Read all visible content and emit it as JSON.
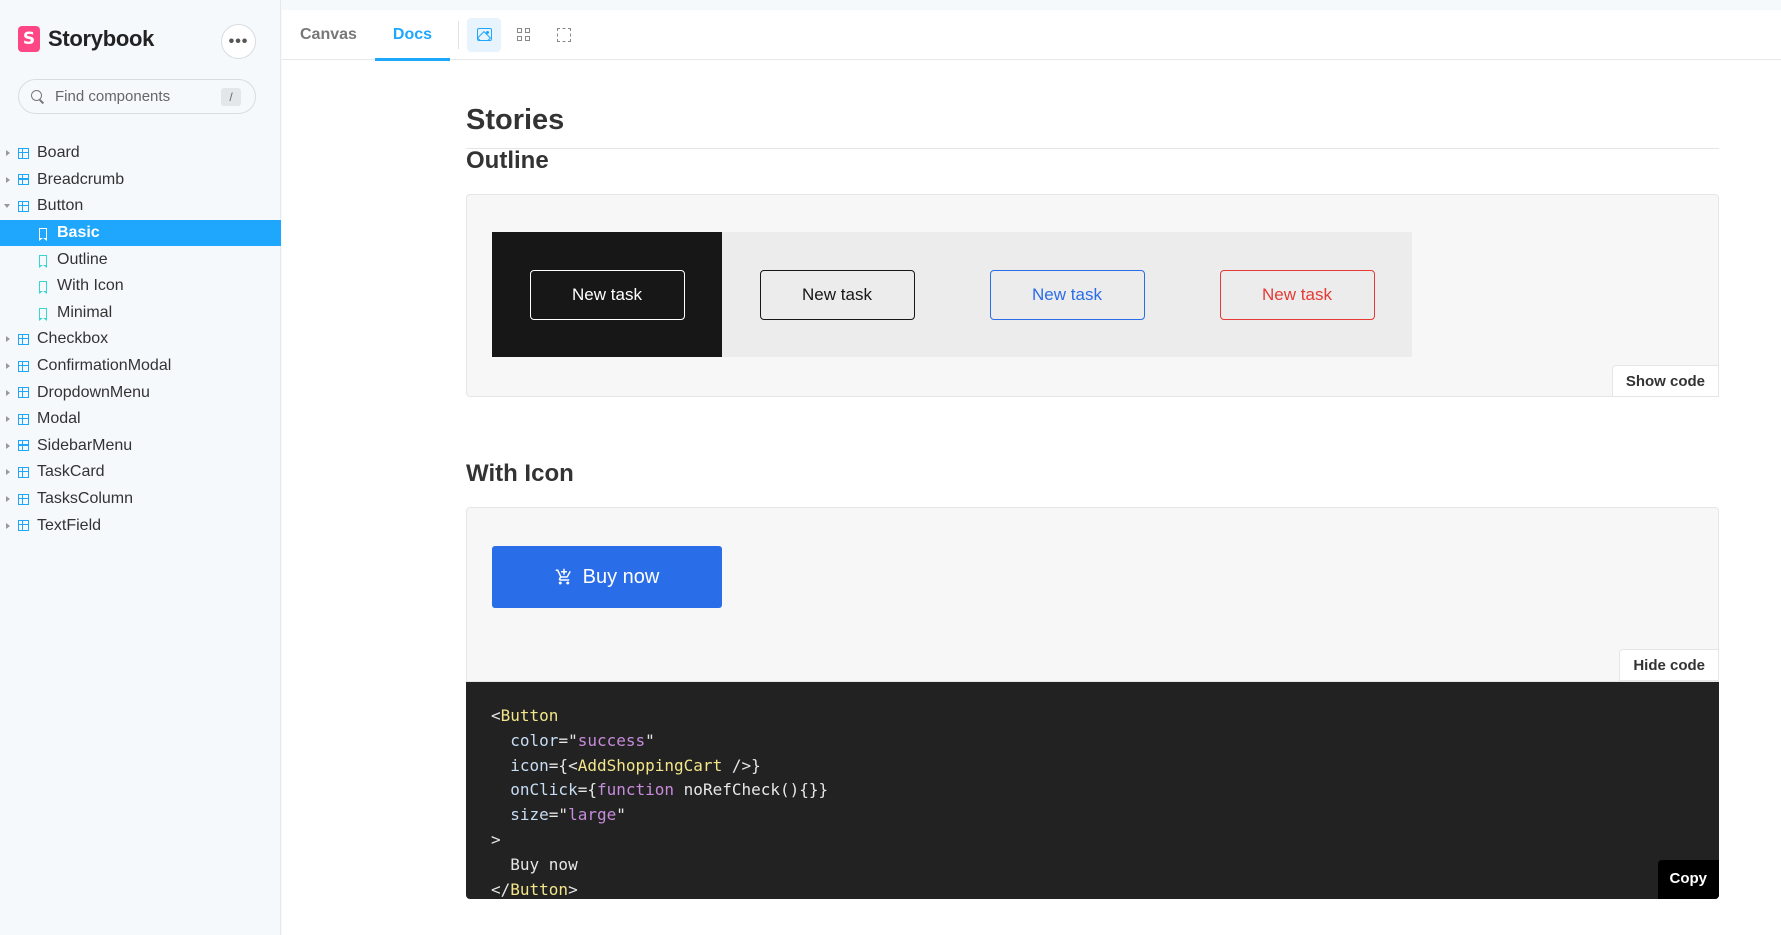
{
  "sidebar": {
    "brand": {
      "logo_letter": "S",
      "name": "Storybook"
    },
    "menu_button": "•••",
    "search": {
      "placeholder": "Find components",
      "shortcut": "/"
    },
    "tree": [
      {
        "label": "Board",
        "type": "component",
        "expanded": false
      },
      {
        "label": "Breadcrumb",
        "type": "component",
        "expanded": false
      },
      {
        "label": "Button",
        "type": "component",
        "expanded": true
      },
      {
        "label": "Basic",
        "type": "story",
        "active": true
      },
      {
        "label": "Outline",
        "type": "story"
      },
      {
        "label": "With Icon",
        "type": "story"
      },
      {
        "label": "Minimal",
        "type": "story"
      },
      {
        "label": "Checkbox",
        "type": "component",
        "expanded": false
      },
      {
        "label": "ConfirmationModal",
        "type": "component",
        "expanded": false
      },
      {
        "label": "DropdownMenu",
        "type": "component",
        "expanded": false
      },
      {
        "label": "Modal",
        "type": "component",
        "expanded": false
      },
      {
        "label": "SidebarMenu",
        "type": "component",
        "expanded": false
      },
      {
        "label": "TaskCard",
        "type": "component",
        "expanded": false
      },
      {
        "label": "TasksColumn",
        "type": "component",
        "expanded": false
      },
      {
        "label": "TextField",
        "type": "component",
        "expanded": false
      }
    ]
  },
  "toolbar": {
    "tabs": [
      {
        "label": "Canvas",
        "active": false
      },
      {
        "label": "Docs",
        "active": true
      }
    ],
    "tools": [
      "image-icon",
      "grid-icon",
      "frame-icon"
    ]
  },
  "docs": {
    "heading": "Stories",
    "outline": {
      "title": "Outline",
      "buttons": [
        {
          "label": "New task",
          "variant": "white-on-dark"
        },
        {
          "label": "New task",
          "variant": "black"
        },
        {
          "label": "New task",
          "variant": "blue"
        },
        {
          "label": "New task",
          "variant": "red"
        }
      ],
      "toggle_label": "Show code"
    },
    "with_icon": {
      "title": "With Icon",
      "button_label": "Buy now",
      "button_icon": "add-shopping-cart-icon",
      "toggle_label": "Hide code",
      "code": {
        "l1_tag": "Button",
        "l2_attr": "color",
        "l2_val": "success",
        "l3_attr": "icon",
        "l3_comp": "AddShoppingCart",
        "l4_attr": "onClick",
        "l4_kw": "function",
        "l4_fn": "noRefCheck(){}",
        "l5_attr": "size",
        "l5_val": "large",
        "l7_text": "Buy now",
        "l8_tag": "Button"
      },
      "copy_label": "Copy"
    }
  },
  "colors": {
    "accent": "#1ea7fd",
    "brand": "#ff4785",
    "primary_button": "#2a6de8",
    "danger": "#e53a35"
  }
}
